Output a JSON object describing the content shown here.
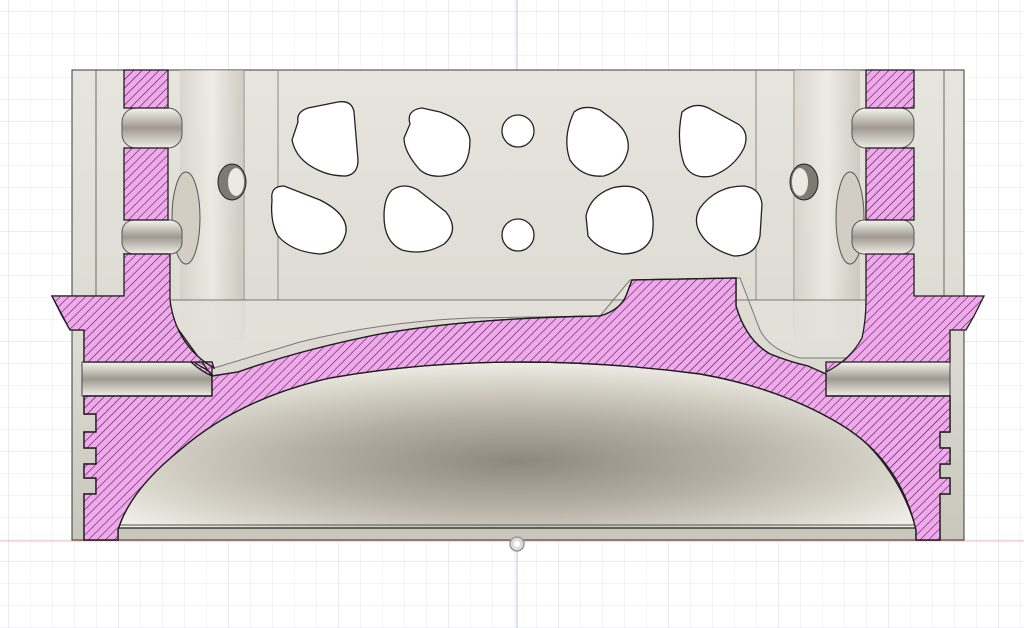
{
  "viewport": {
    "view": "section-analysis",
    "background_color": "#ffffff",
    "grid_color": "#e6e8ee",
    "grid_major_color": "#d4d7de",
    "axis_vertical_color": "#b9bde8",
    "axis_horizontal_color": "#f0b7a8",
    "section_fill_color": "#f2a8ec",
    "section_hatch_color": "#2c1a34",
    "body_color": "#dcdad2",
    "edge_color": "#222222"
  },
  "model": {
    "part": "piston",
    "section_cut": true,
    "features": [
      "cut-face-left",
      "cut-face-right",
      "crown",
      "ring-grooves-left",
      "ring-grooves-right",
      "skirt-window",
      "pin-boss-left",
      "pin-boss-right",
      "underside-dome"
    ]
  }
}
